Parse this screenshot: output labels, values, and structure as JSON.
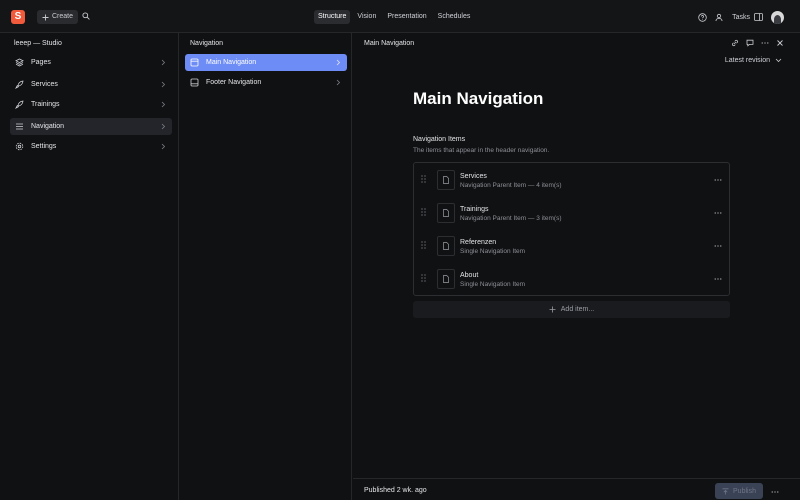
{
  "topbar": {
    "logo_letter": "S",
    "create_label": "Create",
    "tabs": [
      "Structure",
      "Vision",
      "Presentation",
      "Schedules"
    ],
    "active_tab": "Structure",
    "tasks_label": "Tasks"
  },
  "structure": {
    "title": "leeep — Studio",
    "items": [
      {
        "label": "Pages",
        "icon": "stack-icon"
      },
      {
        "label": "Services",
        "icon": "rocket-icon"
      },
      {
        "label": "Trainings",
        "icon": "rocket-icon"
      },
      {
        "label": "Navigation",
        "icon": "menu-icon",
        "selected": true
      },
      {
        "label": "Settings",
        "icon": "gear-icon"
      }
    ]
  },
  "navigation_pane": {
    "title": "Navigation",
    "items": [
      {
        "label": "Main Navigation",
        "icon": "window-icon",
        "selected": true
      },
      {
        "label": "Footer Navigation",
        "icon": "window-footer-icon"
      }
    ]
  },
  "document": {
    "pane_title": "Main Navigation",
    "revision_label": "Latest revision",
    "title": "Main Navigation",
    "field_label": "Navigation Items",
    "field_description": "The items that appear in the header navigation.",
    "items": [
      {
        "title": "Services",
        "subtitle": "Navigation Parent Item — 4 item(s)"
      },
      {
        "title": "Trainings",
        "subtitle": "Navigation Parent Item — 3 item(s)"
      },
      {
        "title": "Referenzen",
        "subtitle": "Single Navigation Item"
      },
      {
        "title": "About",
        "subtitle": "Single Navigation Item"
      }
    ],
    "add_item_label": "Add item...",
    "published_label": "Published 2 wk. ago",
    "publish_label": "Publish"
  },
  "colors": {
    "accent": "#6e8cf5",
    "logo": "#f25a3c",
    "background": "#101112"
  }
}
